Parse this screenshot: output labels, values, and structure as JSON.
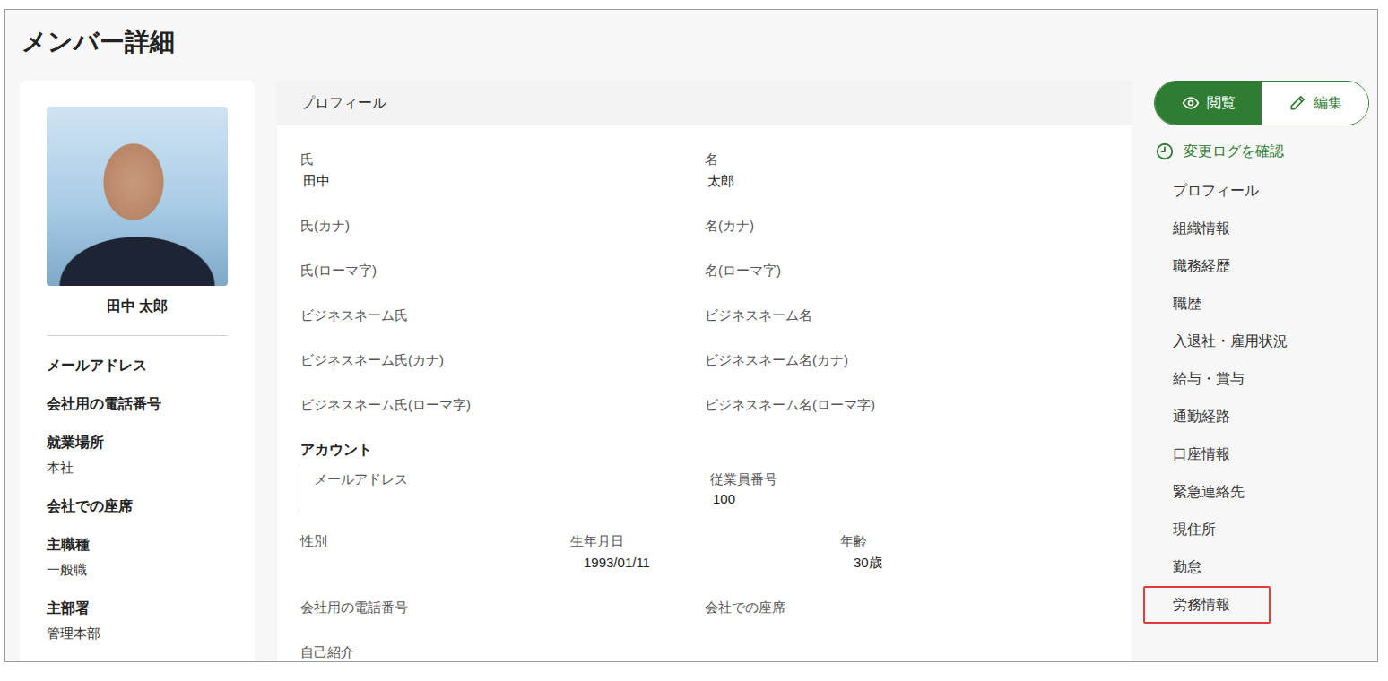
{
  "page": {
    "title": "メンバー詳細"
  },
  "member_card": {
    "name": "田中 太郎",
    "fields": [
      {
        "label": "メールアドレス"
      },
      {
        "label": "会社用の電話番号"
      },
      {
        "label": "就業場所",
        "value": "本社"
      },
      {
        "label": "会社での座席"
      },
      {
        "label": "主職種",
        "value": "一般職"
      },
      {
        "label": "主部署",
        "value": "管理本部"
      }
    ]
  },
  "profile": {
    "header": "プロフィール",
    "name_rows": [
      [
        {
          "label": "氏",
          "value": "田中"
        },
        {
          "label": "名",
          "value": "太郎"
        }
      ],
      [
        {
          "label": "氏(カナ)"
        },
        {
          "label": "名(カナ)"
        }
      ],
      [
        {
          "label": "氏(ローマ字)"
        },
        {
          "label": "名(ローマ字)"
        }
      ],
      [
        {
          "label": "ビジネスネーム氏"
        },
        {
          "label": "ビジネスネーム名"
        }
      ],
      [
        {
          "label": "ビジネスネーム氏(カナ)"
        },
        {
          "label": "ビジネスネーム名(カナ)"
        }
      ],
      [
        {
          "label": "ビジネスネーム氏(ローマ字)"
        },
        {
          "label": "ビジネスネーム名(ローマ字)"
        }
      ]
    ],
    "account": {
      "title": "アカウント",
      "fields": [
        {
          "label": "メールアドレス"
        },
        {
          "label": "従業員番号",
          "value": "100"
        }
      ]
    },
    "personal": [
      {
        "label": "性別"
      },
      {
        "label": "生年月日",
        "value": "1993/01/11"
      },
      {
        "label": "年齢",
        "value": "30歳"
      }
    ],
    "contact": [
      {
        "label": "会社用の電話番号"
      },
      {
        "label": "会社での座席"
      }
    ],
    "self_intro": {
      "label": "自己紹介"
    }
  },
  "view_toggle": [
    {
      "label": "閲覧",
      "kind": "view",
      "selected": true
    },
    {
      "label": "編集",
      "kind": "edit",
      "selected": false
    }
  ],
  "change_log": {
    "label": "変更ログを確認"
  },
  "nav": [
    {
      "label": "プロフィール",
      "highlighted": false
    },
    {
      "label": "組織情報",
      "highlighted": false
    },
    {
      "label": "職務経歴",
      "highlighted": false
    },
    {
      "label": "職歴",
      "highlighted": false
    },
    {
      "label": "入退社・雇用状況",
      "highlighted": false
    },
    {
      "label": "給与・賞与",
      "highlighted": false
    },
    {
      "label": "通勤経路",
      "highlighted": false
    },
    {
      "label": "口座情報",
      "highlighted": false
    },
    {
      "label": "緊急連絡先",
      "highlighted": false
    },
    {
      "label": "現住所",
      "highlighted": false
    },
    {
      "label": "勤怠",
      "highlighted": false
    },
    {
      "label": "労務情報",
      "highlighted": true
    }
  ]
}
